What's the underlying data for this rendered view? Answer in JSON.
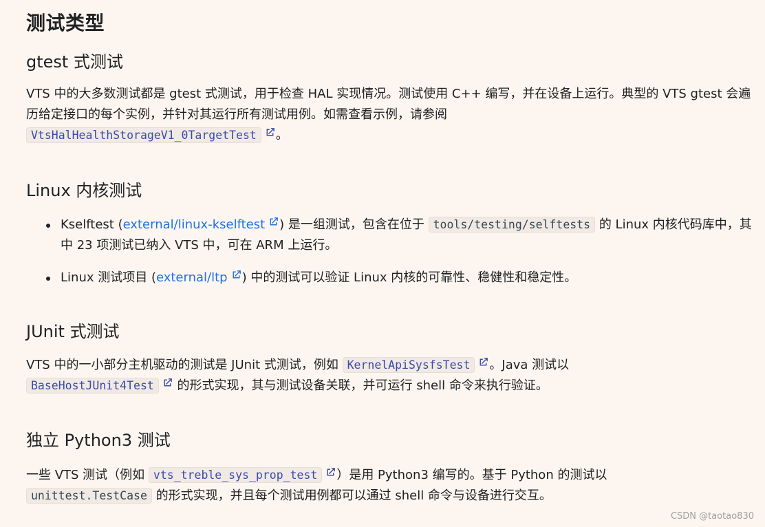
{
  "page_title": "测试类型",
  "sections": {
    "gtest": {
      "heading": "gtest 式测试",
      "text1": "VTS 中的大多数测试都是 gtest 式测试，用于检查 HAL 实现情况。测试使用 C++ 编写，并在设备上运行。典型的 VTS gtest 会遍历给定接口的每个实例，并针对其运行所有测试用例。如需查看示例，请参阅",
      "code_link": "VtsHalHealthStorageV1_0TargetTest",
      "text2": "。"
    },
    "linux": {
      "heading": "Linux 内核测试",
      "item1": {
        "t1": "Kselftest (",
        "link": "external/linux-kselftest",
        "t2": ") 是一组测试，包含在位于 ",
        "code": "tools/testing/selftests",
        "t3": " 的 Linux 内核代码库中，其中 23 项测试已纳入 VTS 中，可在 ARM 上运行。"
      },
      "item2": {
        "t1": "Linux 测试项目 (",
        "link": "external/ltp",
        "t2": ") 中的测试可以验证 Linux 内核的可靠性、稳健性和稳定性。"
      }
    },
    "junit": {
      "heading": "JUnit 式测试",
      "t1": "VTS 中的一小部分主机驱动的测试是 JUnit 式测试，例如 ",
      "code_link1": "KernelApiSysfsTest",
      "t2": "。Java 测试以",
      "code_link2": "BaseHostJUnit4Test",
      "t3": " 的形式实现，其与测试设备关联，并可运行 shell 命令来执行验证。"
    },
    "python": {
      "heading": "独立 Python3 测试",
      "t1": "一些 VTS 测试（例如 ",
      "code_link": "vts_treble_sys_prop_test",
      "t2": "）是用 Python3 编写的。基于 Python 的测试以",
      "code": "unittest.TestCase",
      "t3": " 的形式实现，并且每个测试用例都可以通过 shell 命令与设备进行交互。"
    }
  },
  "watermark": "CSDN @taotao830",
  "colors": {
    "background": "#fdf6f0",
    "link": "#1a73e8",
    "code_link": "#3949ab"
  },
  "icons": {
    "external_link": "external-link-icon"
  }
}
